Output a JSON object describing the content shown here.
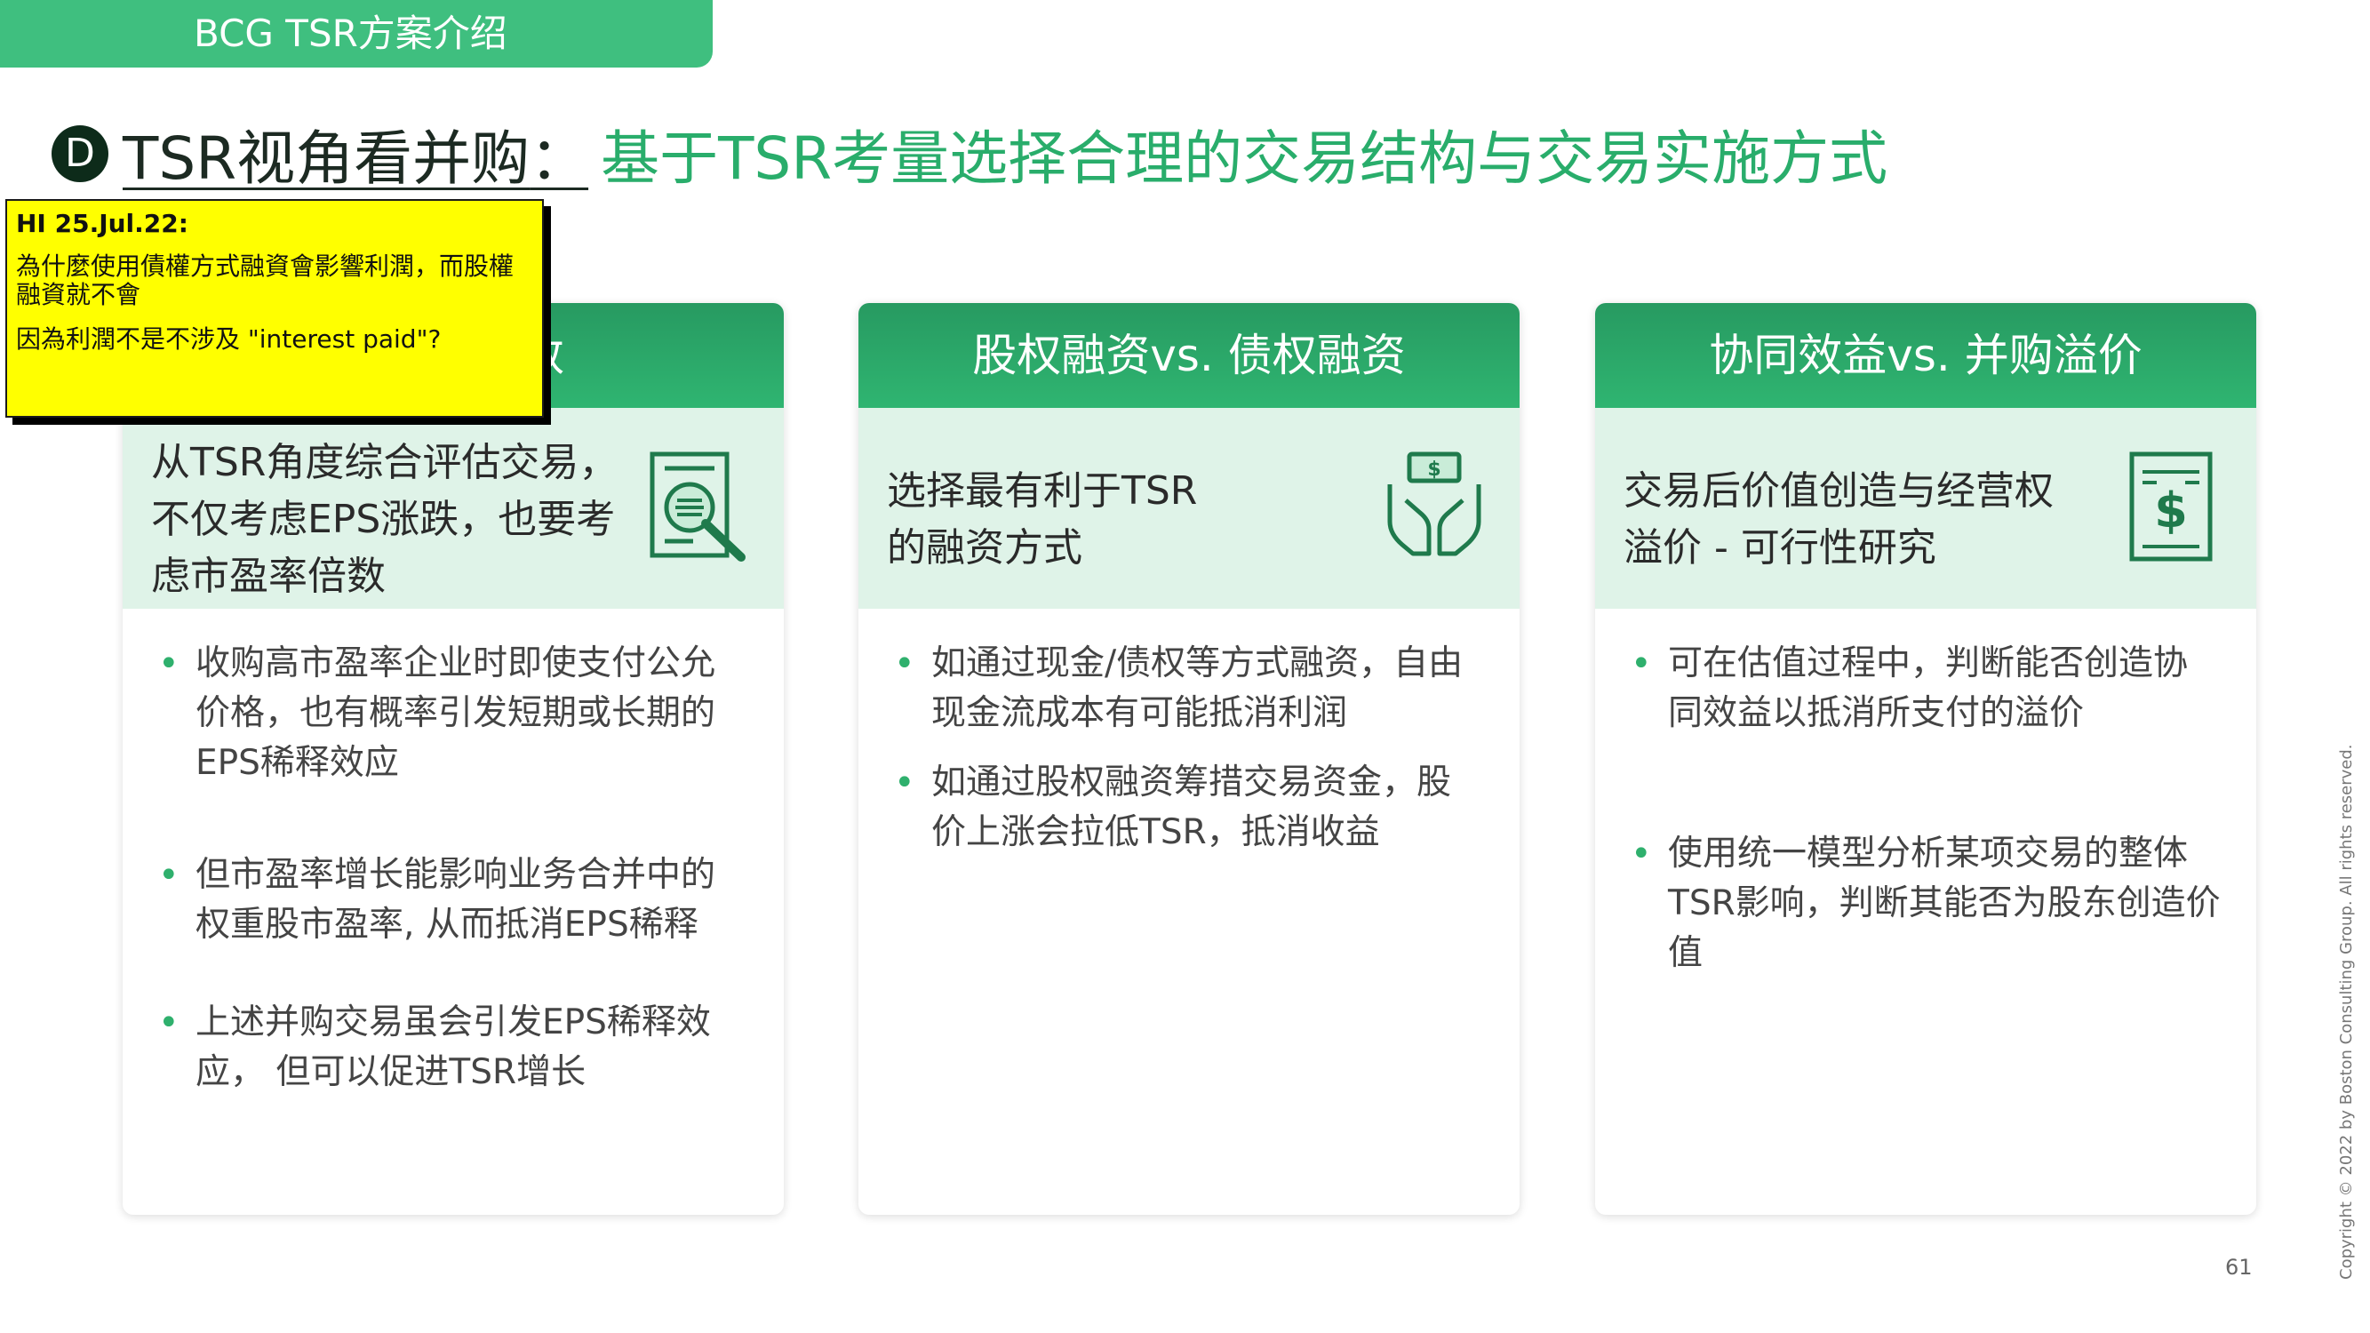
{
  "tab": {
    "label": "BCG TSR方案介绍"
  },
  "title": {
    "badge": "D",
    "main": "TSR视角看并购",
    "colon": "：",
    "subtitle": "基于TSR考量选择合理的交易结构与交易实施方式"
  },
  "cards": [
    {
      "header": "市盈率倍数",
      "band_text": "从TSR角度综合评估交易，不仅考虑EPS涨跌，也要考虑市盈率倍数",
      "icon": "document-magnifier-icon",
      "bullets": [
        "收购高市盈率企业时即使支付公允价格，也有概率引发短期或长期的EPS稀释效应",
        "但市盈率增长能影响业务合并中的权重股市盈率, 从而抵消EPS稀释",
        "上述并购交易虽会引发EPS稀释效应， 但可以促进TSR增长"
      ]
    },
    {
      "header": "股权融资vs. 债权融资",
      "band_text": "选择最有利于TSR的融资方式",
      "icon": "hands-money-icon",
      "bullets": [
        "如通过现金/债权等方式融资，自由现金流成本有可能抵消利润",
        "如通过股权融资筹措交易资金，股价上涨会拉低TSR，抵消收益"
      ]
    },
    {
      "header": "协同效益vs. 并购溢价",
      "band_text": "交易后价值创造与经营权溢价 - 可行性研究",
      "icon": "dollar-document-icon",
      "bullets": [
        "可在估值过程中，判断能否创造协同效益以抵消所支付的溢价",
        "使用统一模型分析某项交易的整体TSR影响，判断其能否为股东创造价值"
      ]
    }
  ],
  "note": {
    "header": "HI 25.Jul.22:",
    "line1": "為什麼使用債權方式融資會影響利潤，而股權融資就不會",
    "line2": "因為利潤不是不涉及 \"interest paid\"?"
  },
  "footer": {
    "copyright": "Copyright © 2022 by Boston Consulting Group. All rights reserved.",
    "page_number": "61"
  },
  "colors": {
    "accent": "#2fb06d",
    "header": "#279a61",
    "band": "#dff3e8",
    "note": "#ffff00"
  }
}
